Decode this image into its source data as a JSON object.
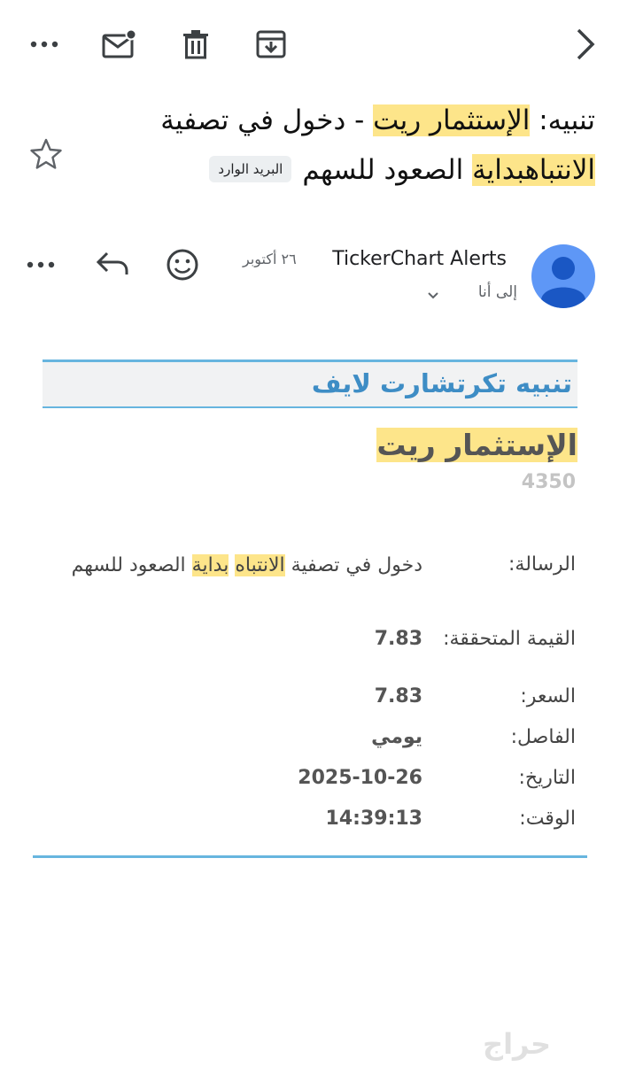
{
  "subject": {
    "prefix": "تنبيه: ",
    "stock": "الإستثمار ريت",
    "dash": " - دخول في تصفية ",
    "hl1": "الانتباه",
    "hl2": "بداية",
    "rest": " الصعود للسهم",
    "label_chip": "البريد الوارد"
  },
  "sender": {
    "name": "TickerChart Alerts",
    "date": "٢٦ أكتوبر",
    "to": "إلى أنا"
  },
  "alert": {
    "header": "تنبيه تكرتشارت لايف",
    "stock_name": "الإستثمار ريت",
    "stock_code": "4350",
    "rows": {
      "message": {
        "label": "الرسالة:",
        "val_a": "دخول في تصفية ",
        "val_hl1": "الانتباه",
        "val_hl2": "بداية",
        "val_b": " الصعود للسهم"
      },
      "target": {
        "label": "القيمة المتحققة:",
        "value": "7.83"
      },
      "price": {
        "label": "السعر:",
        "value": "7.83"
      },
      "interval": {
        "label": "الفاصل:",
        "value": "يومي"
      },
      "date": {
        "label": "التاريخ:",
        "value": "2025-10-26"
      },
      "time": {
        "label": "الوقت:",
        "value": "14:39:13"
      }
    }
  },
  "watermark": "حراج",
  "colors": {
    "highlight": "#fde58a",
    "accent_blue": "#3e8dc5",
    "rule_blue": "#67b5df",
    "avatar_blue": "#5e97f6"
  },
  "icons": [
    "more-vert-icon",
    "mark-unread-icon",
    "trash-icon",
    "archive-icon",
    "back-chevron-icon",
    "star-icon",
    "reply-icon",
    "emoji-icon",
    "chevron-down-icon"
  ]
}
